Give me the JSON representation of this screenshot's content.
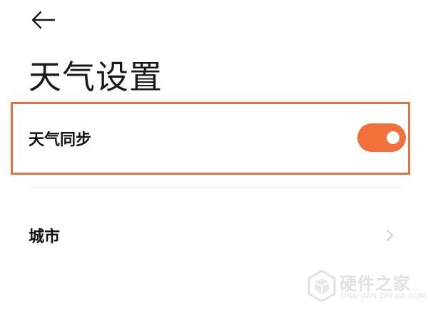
{
  "header": {
    "back_icon": "arrow-left-icon",
    "title": "天气设置"
  },
  "settings": {
    "sync": {
      "label": "天气同步",
      "toggle_on": true,
      "highlight_color": "#e8703f",
      "toggle_color": "#f2703a"
    },
    "city": {
      "label": "城市",
      "chevron_icon": "chevron-right-icon"
    }
  },
  "watermark": {
    "title": "硬件之家",
    "subtitle": "YING JIAN ZHI JIA.COM"
  }
}
